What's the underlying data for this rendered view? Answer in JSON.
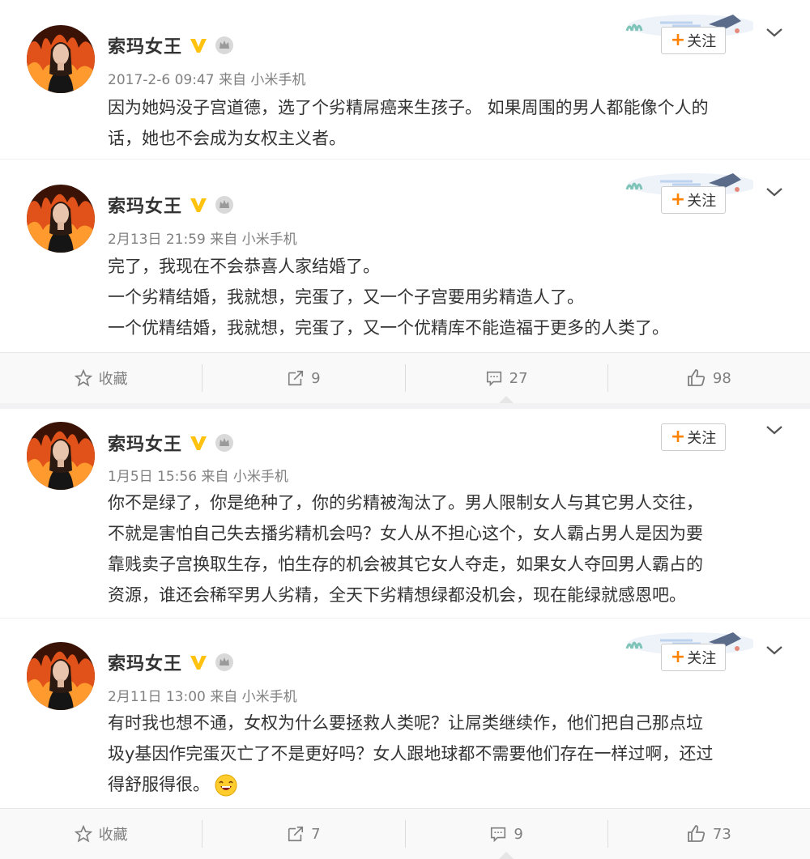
{
  "colors": {
    "accent": "#ff8200",
    "text": "#333333",
    "meta": "#808080",
    "verified": "#ffc20e"
  },
  "posts": [
    {
      "author": "索玛女王",
      "meta": "2017-2-6 09:47 来自 小米手机",
      "follow_label": "关注",
      "lines": [
        "因为她妈没子宫道德，选了个劣精屌癌来生孩子。 如果周围的男人都能像个人的",
        "话，她也不会成为女权主义者。"
      ]
    },
    {
      "author": "索玛女王",
      "meta": "2月13日 21:59 来自 小米手机",
      "follow_label": "关注",
      "lines": [
        "完了，我现在不会恭喜人家结婚了。",
        "一个劣精结婚，我就想，完蛋了，又一个子宫要用劣精造人了。",
        "一个优精结婚，我就想，完蛋了，又一个优精库不能造福于更多的人类了。"
      ],
      "actions": {
        "favorite": "收藏",
        "repost": "9",
        "comment": "27",
        "like": "98"
      }
    },
    {
      "author": "索玛女王",
      "meta": "1月5日 15:56 来自 小米手机",
      "follow_label": "关注",
      "lines": [
        "你不是绿了，你是绝种了，你的劣精被淘汰了。男人限制女人与其它男人交往，",
        "不就是害怕自己失去播劣精机会吗？女人从不担心这个，女人霸占男人是因为要",
        "靠贱卖子宫换取生存，怕生存的机会被其它女人夺走，如果女人夺回男人霸占的",
        "资源，谁还会稀罕男人劣精，全天下劣精想绿都没机会，现在能绿就感恩吧。"
      ]
    },
    {
      "author": "索玛女王",
      "meta": "2月11日 13:00 来自 小米手机",
      "follow_label": "关注",
      "lines": [
        "有时我也想不通，女权为什么要拯救人类呢？让屌类继续作，他们把自己那点垃",
        "圾y基因作完蛋灭亡了不是更好吗？女人跟地球都不需要他们存在一样过啊，还过",
        "得舒服得很。"
      ],
      "emoji": "laughing-emoji",
      "actions": {
        "favorite": "收藏",
        "repost": "7",
        "comment": "9",
        "like": "73"
      }
    }
  ]
}
